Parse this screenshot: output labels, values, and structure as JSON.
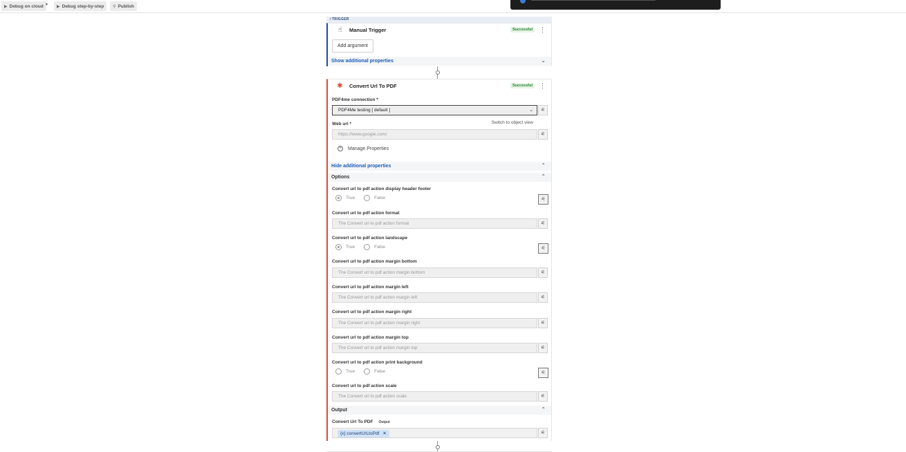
{
  "toolbar": {
    "debug_cloud": "Debug on cloud",
    "debug_step": "Debug step-by-step",
    "publish": "Publish"
  },
  "trigger_section": {
    "tag": "TRIGGER",
    "title": "Manual Trigger",
    "status": "Successful",
    "add_argument": "Add argument",
    "show_props": "Show additional properties"
  },
  "action": {
    "title": "Convert Url To PDF",
    "status": "Successful",
    "connection_label": "PDF4me connection *",
    "connection_value": "PDF4Me testing [ default ]",
    "web_url_label": "Web url *",
    "switch_view": "Switch to object view",
    "web_url_placeholder": "https://www.google.com/",
    "manage_properties": "Manage Properties",
    "hide_props": "Hide additional properties",
    "options_label": "Options",
    "true_label": "True",
    "false_label": "False",
    "opt_header_footer": "Convert url to pdf action display header footer",
    "opt_format": "Convert url to pdf action format",
    "opt_format_ph": "The Convert url to pdf action format",
    "opt_landscape": "Convert url to pdf action landscape",
    "opt_mb": "Convert url to pdf action margin bottom",
    "opt_mb_ph": "The Convert url to pdf action margin bottom",
    "opt_ml": "Convert url to pdf action margin left",
    "opt_ml_ph": "The Convert url to pdf action margin left",
    "opt_mr": "Convert url to pdf action margin right",
    "opt_mr_ph": "The Convert url to pdf action margin right",
    "opt_mt": "Convert url to pdf action margin top",
    "opt_mt_ph": "The Convert url to pdf action margin top",
    "opt_bg": "Convert url to pdf action print background",
    "opt_scale": "Convert url to pdf action scale",
    "opt_scale_ph": "The Convert url to pdf action scale",
    "output_label": "Output",
    "output_field_label": "Convert Url To PDF",
    "output_tag": "Output",
    "output_chip": "{x} convertUrLtoPdf"
  }
}
